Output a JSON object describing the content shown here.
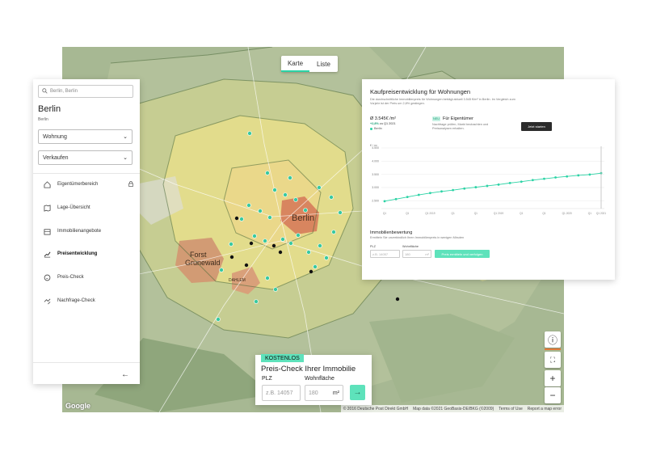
{
  "map": {
    "tabs": [
      {
        "label": "Karte",
        "active": true
      },
      {
        "label": "Liste",
        "active": false
      }
    ],
    "google_logo": "Google",
    "attribution": [
      "© 2016 Deutsche Post Direkt GmbH",
      "Map data ©2021 GeoBasis-DE/BKG (©2009)",
      "Terms of Use",
      "Report a map error"
    ],
    "place_labels": {
      "berlin": "Berlin",
      "forst": "Forst\nGrunewald",
      "dahlem": "DAHLEM"
    }
  },
  "sidebar": {
    "search_placeholder": "Berlin, Berlin",
    "city_title": "Berlin",
    "city_subtitle": "Berlin",
    "property_type": "Wohnung",
    "transaction_type": "Verkaufen",
    "items": [
      {
        "label": "Eigentümerbereich",
        "icon": "house-icon",
        "locked": true,
        "active": false
      },
      {
        "label": "Lage-Übersicht",
        "icon": "map-icon",
        "locked": false,
        "active": false
      },
      {
        "label": "Immobilienangebote",
        "icon": "building-icon",
        "locked": false,
        "active": false
      },
      {
        "label": "Preisentwicklung",
        "icon": "chart-line-icon",
        "locked": false,
        "active": true
      },
      {
        "label": "Preis-Check",
        "icon": "price-tag-icon",
        "locked": false,
        "active": false
      },
      {
        "label": "Nachfrage-Check",
        "icon": "demand-icon",
        "locked": false,
        "active": false
      }
    ]
  },
  "chart_card": {
    "title": "Kaufpreisentwicklung für Wohnungen",
    "description": "Die durchschnittliche Immobilienpreis für Wohnungen beträgt aktuell 3.545 €/m² in Berlin. Im Vergleich zum Vorjahr ist der Preis um 2,8% gestiegen.",
    "avg_value": "Ø 3.545€ /m²",
    "pct_change": "+2,8%",
    "pct_suffix": " zu Q1 2021",
    "legend_label": "Berlin",
    "new_badge": "NEU",
    "owner_title": "Für Eigentümer",
    "owner_desc": "Nachfrage prüfen, Markt beobachten und Preisanalysen erhalten.",
    "start_button": "Jetzt starten",
    "valuation_title": "Immobilienbewertung",
    "valuation_desc": "Ermitteln Sie unverbindlich Ihren Immobilienpreis in wenigen Minuten",
    "plz_label": "PLZ",
    "area_label": "Wohnfläche",
    "plz_placeholder": "z.B. 14057",
    "area_placeholder": "180",
    "area_unit": "m²",
    "estimate_button": "Preis ermitteln und verfolgen"
  },
  "chart_data": {
    "type": "line",
    "title": "",
    "xlabel": "",
    "ylabel": "€ / m²",
    "x": [
      "Q1",
      "Q2",
      "Q3",
      "Q4",
      "Q1",
      "Q2",
      "Q3",
      "Q4",
      "Q1",
      "Q2",
      "Q3",
      "Q4",
      "Q1",
      "Q2",
      "Q3",
      "Q4",
      "Q1",
      "Q2",
      "Q3",
      "Q4"
    ],
    "x_tick_labels": [
      {
        "index": 0,
        "label": "Q1"
      },
      {
        "index": 2,
        "label": "Q1"
      },
      {
        "index": 4,
        "label": "Q1 2019"
      },
      {
        "index": 6,
        "label": "Q1"
      },
      {
        "index": 8,
        "label": "Q1"
      },
      {
        "index": 10,
        "label": "Q1 2019"
      },
      {
        "index": 12,
        "label": "Q1"
      },
      {
        "index": 14,
        "label": "Q1"
      },
      {
        "index": 16,
        "label": "Q1 2020"
      },
      {
        "index": 18,
        "label": "Q1"
      },
      {
        "index": 19,
        "label": "Q1 2021"
      }
    ],
    "series": [
      {
        "name": "Berlin",
        "values": [
          2480,
          2560,
          2640,
          2720,
          2790,
          2850,
          2900,
          2960,
          3010,
          3060,
          3110,
          3170,
          3220,
          3280,
          3330,
          3380,
          3420,
          3460,
          3490,
          3545
        ]
      }
    ],
    "yticks": [
      "2.500",
      "3.000",
      "3.500",
      "4.000",
      "4.500"
    ],
    "ylim": [
      2200,
      4500
    ],
    "grid": true
  },
  "price_check": {
    "badge": "KOSTENLOS",
    "title": "Preis-Check Ihrer Immobilie",
    "plz_label": "PLZ",
    "area_label": "Wohnfläche",
    "plz_placeholder": "z.B. 14057",
    "area_placeholder": "180",
    "area_unit": "m²"
  },
  "colors": {
    "accent": "#5ee2bb",
    "accent_dark": "#1a9e76",
    "line": "#2bd3a5"
  }
}
